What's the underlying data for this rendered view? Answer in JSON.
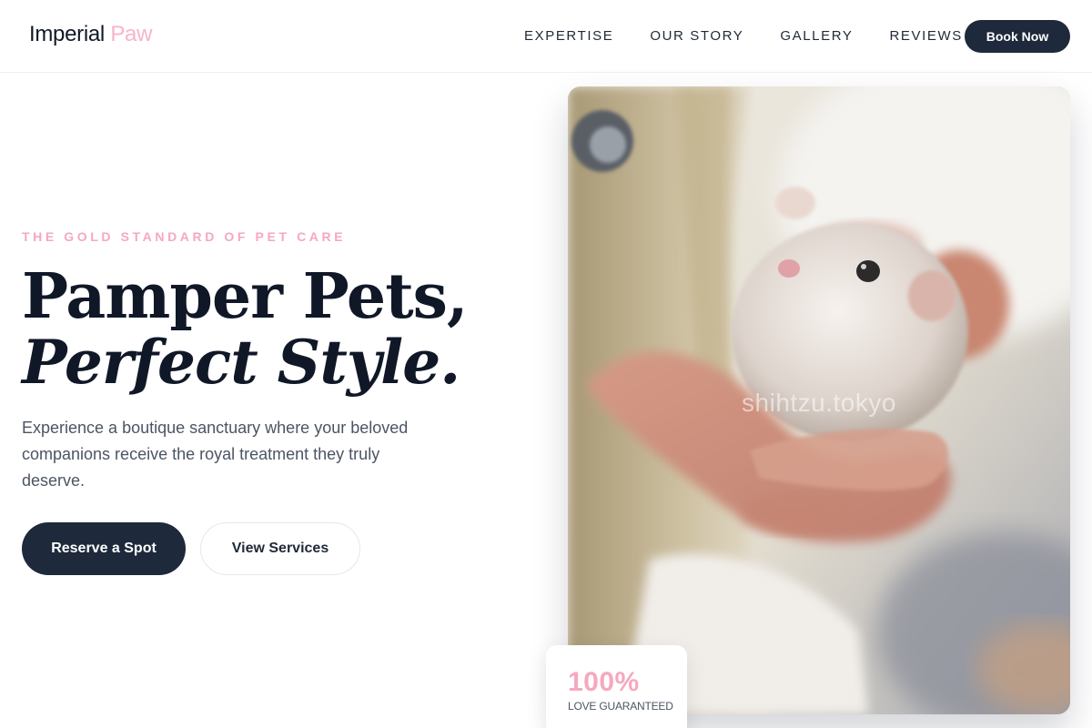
{
  "header": {
    "brand_main": "Imperial",
    "brand_accent": "Paw",
    "nav": [
      "EXPERTISE",
      "OUR STORY",
      "GALLERY",
      "REVIEWS"
    ],
    "cta": "Book Now"
  },
  "hero": {
    "eyebrow": "THE GOLD STANDARD OF PET CARE",
    "headline_line1": "Pamper Pets,",
    "headline_line2": "Perfect Style.",
    "lede": "Experience a boutique sanctuary where your beloved companions receive the royal treatment they truly deserve.",
    "primary_button": "Reserve a Spot",
    "secondary_button": "View Services"
  },
  "photo": {
    "watermark": "shihtzu.tokyo"
  },
  "stat": {
    "value": "100%",
    "label": "LOVE GUARANTEED"
  },
  "colors": {
    "accent_pink": "#f5a8bf",
    "navy": "#1e293b"
  }
}
